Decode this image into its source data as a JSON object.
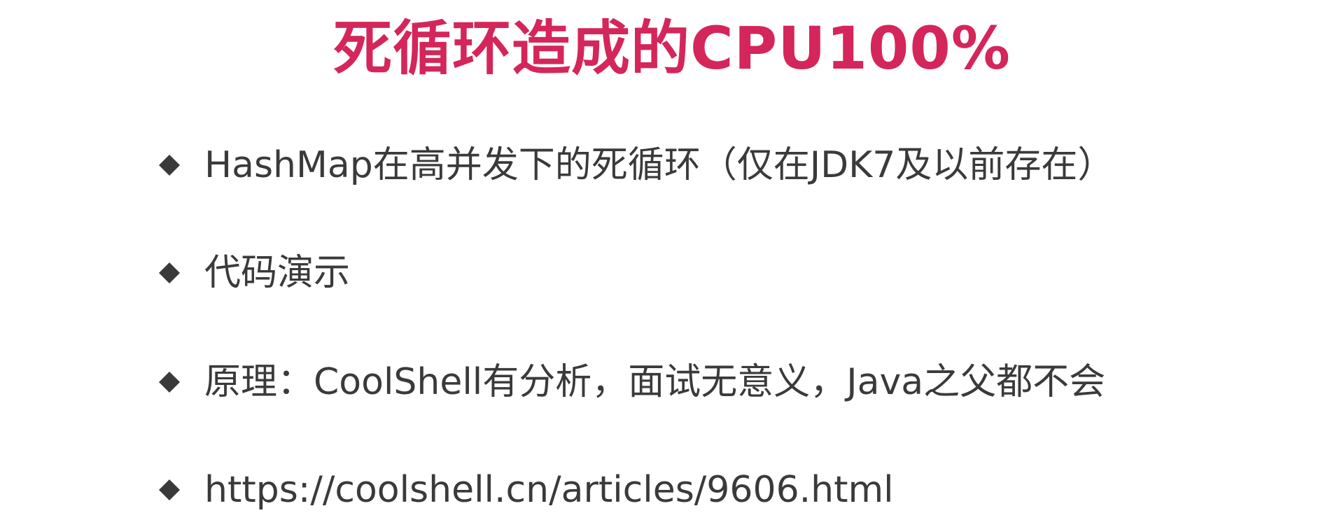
{
  "slide": {
    "title": "死循环造成的CPU100%",
    "bullets": [
      {
        "text": "HashMap在高并发下的死循环（仅在JDK7及以前存在）"
      },
      {
        "text": "代码演示"
      },
      {
        "text": "原理：CoolShell有分析，面试无意义，Java之父都不会"
      },
      {
        "text": "https://coolshell.cn/articles/9606.html"
      }
    ],
    "bullet_icon": "diamond-bullet-icon"
  },
  "colors": {
    "title": "#d4265a",
    "text": "#3a3a3a",
    "bullet": "#3a3a3a",
    "background": "#ffffff"
  }
}
